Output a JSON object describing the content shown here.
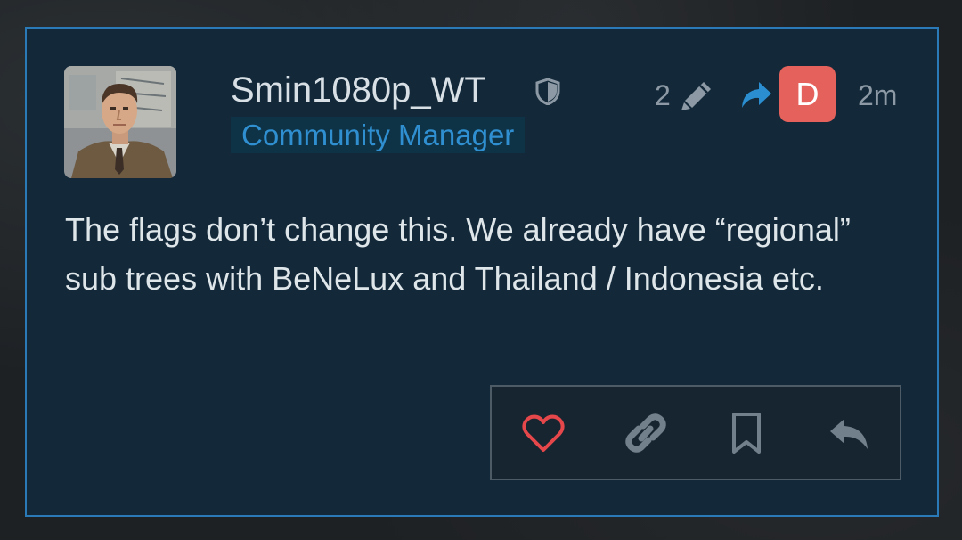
{
  "post": {
    "username": "Smin1080p_WT",
    "user_title": "Community Manager",
    "edit_count": "2",
    "reply_to_avatar_letter": "D",
    "date": "2m",
    "body": "The flags don’t change this. We already have “regional” sub trees with BeNeLux and Thailand / Indonesia etc."
  },
  "icons": {
    "moderator": "shield-icon",
    "edits": "pencil-icon",
    "reply_to": "share-arrow-icon",
    "like": "heart-icon",
    "copy_link": "link-icon",
    "bookmark": "bookmark-icon",
    "reply": "reply-icon"
  },
  "colors": {
    "card_background": "#13293a",
    "card_border": "#2a7ab8",
    "user_title": "#2f8fd0",
    "reply_avatar": "#e5625c",
    "like": "#e5474b"
  }
}
